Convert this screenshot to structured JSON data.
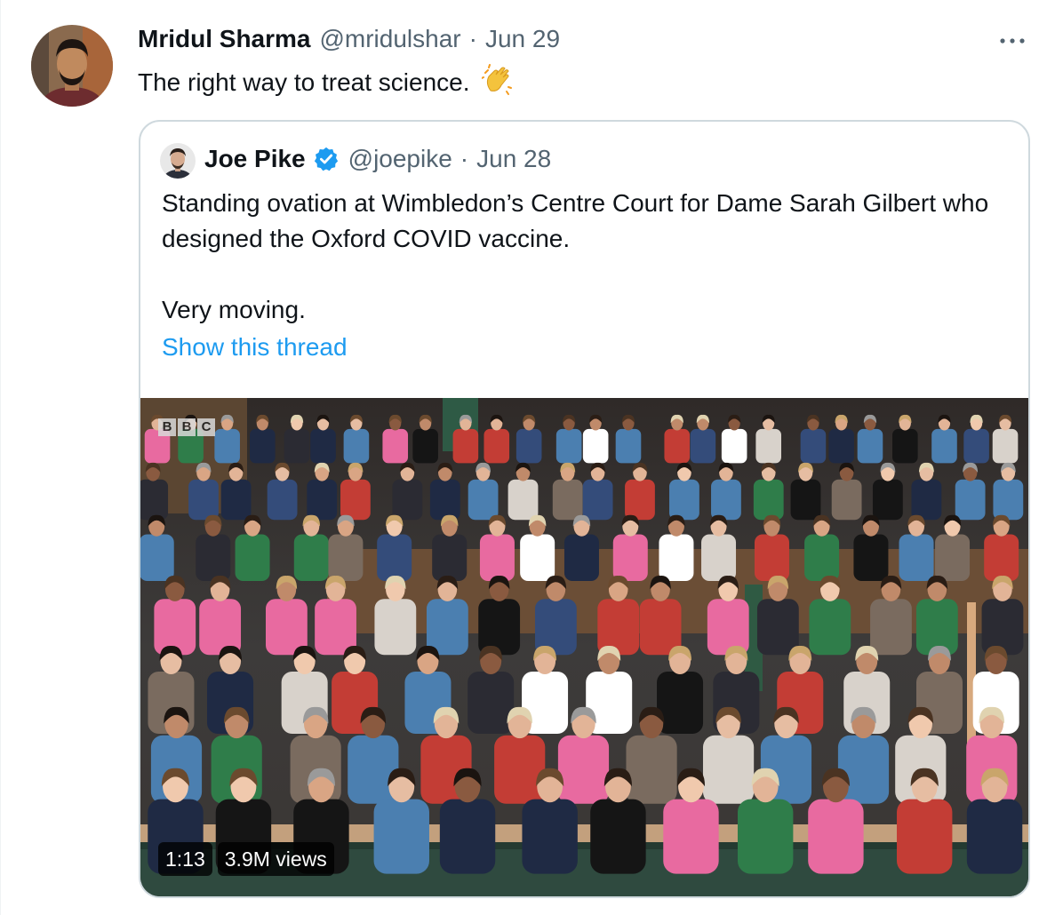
{
  "tweet": {
    "author_name": "Mridul Sharma",
    "author_handle": "@mridulshar",
    "separator": "·",
    "date": "Jun 29",
    "text": "The right way to treat science.",
    "emoji": "clapping-hands",
    "more_icon": "more-horizontal-icon"
  },
  "quoted": {
    "author_name": "Joe Pike",
    "verified": true,
    "author_handle": "@joepike",
    "separator": "·",
    "date": "Jun 28",
    "text_line1": "Standing ovation at Wimbledon’s Centre Court for Dame Sarah Gilbert who designed the Oxford COVID vaccine.",
    "text_line2": "Very moving.",
    "show_thread": "Show this thread"
  },
  "video": {
    "watermark": [
      "B",
      "B",
      "C"
    ],
    "duration": "1:13",
    "views": "3.9M views"
  },
  "colors": {
    "link": "#1d9bf0",
    "secondary": "#536471",
    "border": "#cfd9de",
    "verified": "#1d9bf0"
  }
}
